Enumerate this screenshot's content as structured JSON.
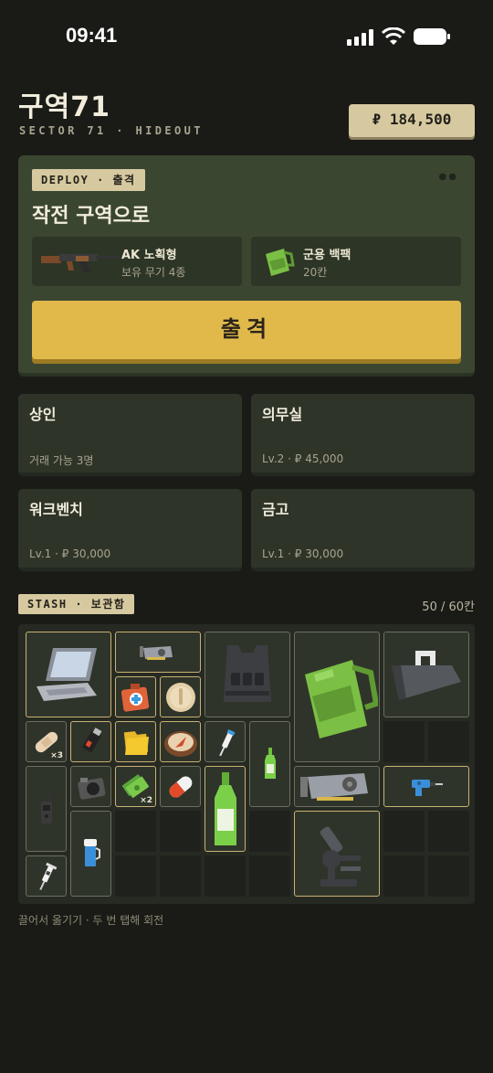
{
  "status_bar": {
    "time": "09:41"
  },
  "header": {
    "title": "구역71",
    "subtitle": "SECTOR 71 · HIDEOUT",
    "currency": "₽ 184,500"
  },
  "deploy": {
    "tag": "DEPLOY · 출격",
    "title": "작전 구역으로",
    "weapon": {
      "name": "AK 노획형",
      "sub": "보유 무기 4종",
      "icon": "rifle-icon"
    },
    "backpack": {
      "name": "군용 백팩",
      "sub": "20칸",
      "icon": "backpack-icon"
    },
    "button": "출격"
  },
  "facilities": [
    {
      "name": "상인",
      "sub": "거래 가능 3명"
    },
    {
      "name": "의무실",
      "sub": "Lv.2 · ₽ 45,000"
    },
    {
      "name": "워크벤치",
      "sub": "Lv.1 · ₽ 30,000"
    },
    {
      "name": "금고",
      "sub": "Lv.1 · ₽ 30,000"
    }
  ],
  "stash": {
    "tag": "STASH · 보관함",
    "count": "50 / 60칸",
    "items": [
      {
        "icon": "laptop-icon"
      },
      {
        "icon": "gpu-icon"
      },
      {
        "icon": "armor-vest-icon"
      },
      {
        "icon": "backpack-icon"
      },
      {
        "icon": "toolbox-icon"
      },
      {
        "icon": "medkit-icon"
      },
      {
        "icon": "bread-icon"
      },
      {
        "icon": "bandage-icon",
        "qty": "×3"
      },
      {
        "icon": "usb-drive-icon"
      },
      {
        "icon": "folder-icon"
      },
      {
        "icon": "compass-icon"
      },
      {
        "icon": "syringe-icon"
      },
      {
        "icon": "small-bottle-icon"
      },
      {
        "icon": "radio-icon"
      },
      {
        "icon": "camera-icon"
      },
      {
        "icon": "cash-icon",
        "qty": "×2"
      },
      {
        "icon": "pill-icon"
      },
      {
        "icon": "bottle-icon"
      },
      {
        "icon": "gpu-icon"
      },
      {
        "icon": "drill-icon"
      },
      {
        "icon": "cup-icon"
      },
      {
        "icon": "microscope-icon"
      },
      {
        "icon": "injector-icon"
      }
    ]
  },
  "hint": "끌어서 옮기기 · 두 번 탭해 회전"
}
